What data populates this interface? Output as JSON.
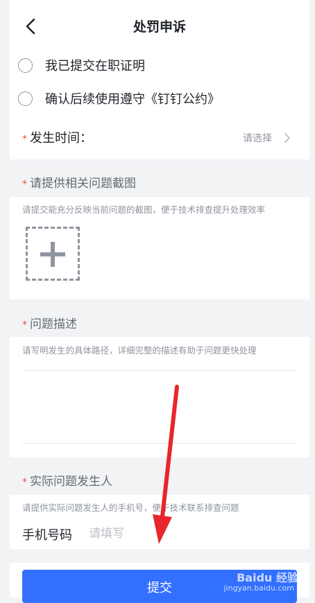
{
  "header": {
    "title": "处罚申诉"
  },
  "checks": [
    {
      "label": "我已提交在职证明"
    },
    {
      "label": "确认后续使用遵守《钉钉公约》"
    }
  ],
  "time": {
    "required": "*",
    "label": "发生时间：",
    "value": "请选择"
  },
  "screenshot": {
    "required": "*",
    "title": "请提供相关问题截图",
    "hint": "请提交能充分反映当前问题的截图，便于技术排查提升处理效率"
  },
  "description": {
    "required": "*",
    "title": "问题描述",
    "hint": "请写明发生的具体路径，详细完整的描述有助于问题更快处理"
  },
  "reporter": {
    "required": "*",
    "title": "实际问题发生人",
    "hint": "请提供实际问题发生人的手机号，便于技术联系排查问题",
    "phone_label": "手机号码",
    "phone_placeholder": "请填写"
  },
  "submit_label": "提交",
  "watermark": {
    "brand": "Baidu 经验",
    "url": "jingyan.baidu.com"
  },
  "colors": {
    "accent": "#3370ff",
    "required": "#f54a45",
    "arrow": "#e8262b"
  }
}
